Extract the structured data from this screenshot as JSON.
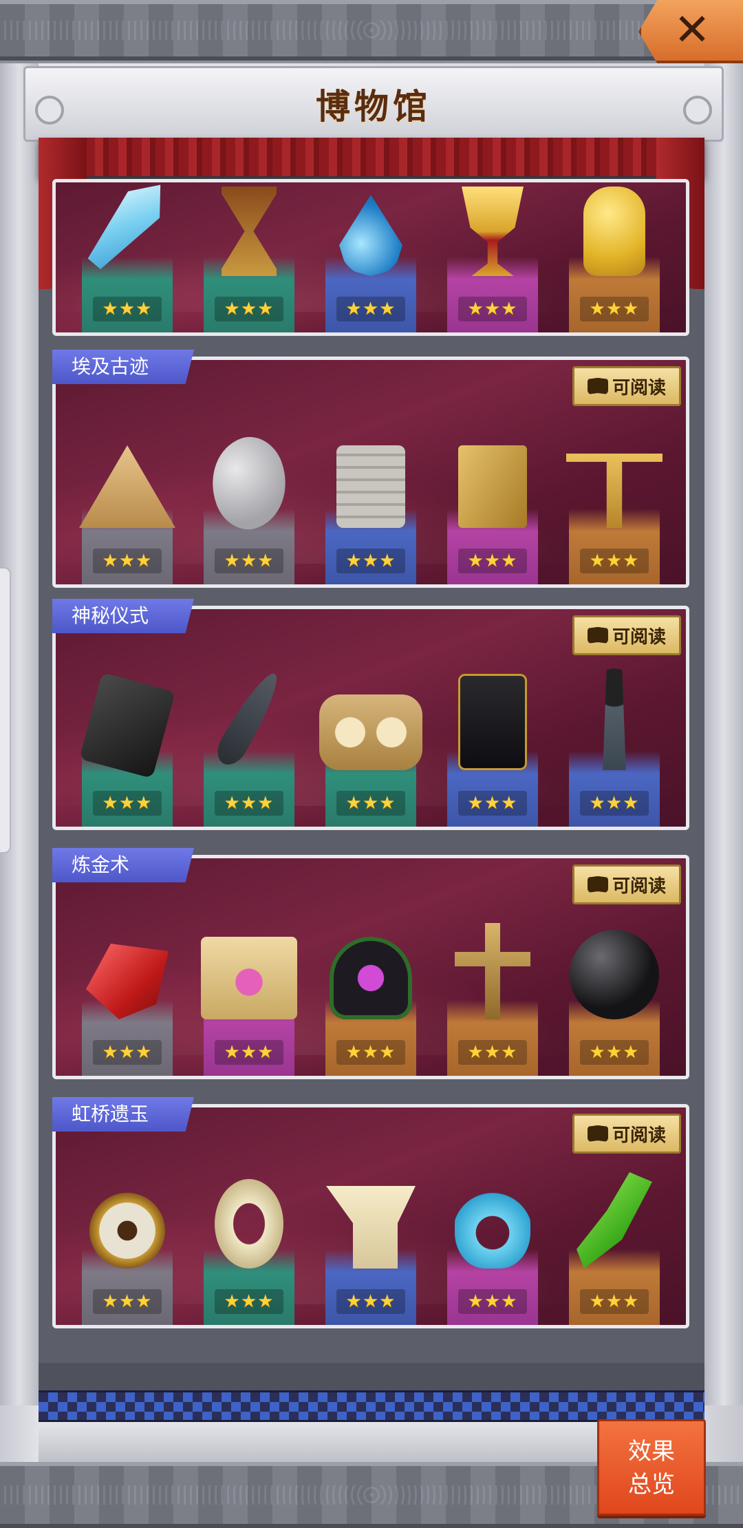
{
  "header": {
    "title": "博物馆",
    "close_icon": "close-icon"
  },
  "panels": [
    {
      "id": "top",
      "name": "",
      "has_read_button": false,
      "items": [
        {
          "icon": "ice-crystal-blade",
          "stars": "★★★",
          "rarity": "teal"
        },
        {
          "icon": "hourglass",
          "stars": "★★★",
          "rarity": "teal"
        },
        {
          "icon": "water-drop",
          "stars": "★★★",
          "rarity": "blue"
        },
        {
          "icon": "jeweled-goblet",
          "stars": "★★★",
          "rarity": "pink"
        },
        {
          "icon": "golden-cobra",
          "stars": "★★★",
          "rarity": "gold"
        }
      ]
    },
    {
      "id": "egypt",
      "name": "埃及古迹",
      "read_label": "可阅读",
      "items": [
        {
          "icon": "eye-pyramid",
          "stars": "★★★",
          "rarity": "gray"
        },
        {
          "icon": "stone-fish",
          "stars": "★★★",
          "rarity": "gray"
        },
        {
          "icon": "glyph-tablet",
          "stars": "★★★",
          "rarity": "blue"
        },
        {
          "icon": "golden-book",
          "stars": "★★★",
          "rarity": "pink"
        },
        {
          "icon": "golden-scales",
          "stars": "★★★",
          "rarity": "gold"
        }
      ]
    },
    {
      "id": "ritual",
      "name": "神秘仪式",
      "read_label": "可阅读",
      "items": [
        {
          "icon": "rune-stone",
          "stars": "★★★",
          "rarity": "teal"
        },
        {
          "icon": "dark-feather",
          "stars": "★★★",
          "rarity": "teal"
        },
        {
          "icon": "owl-mask",
          "stars": "★★★",
          "rarity": "teal"
        },
        {
          "icon": "pentagram-book",
          "stars": "★★★",
          "rarity": "blue"
        },
        {
          "icon": "hanging-charm",
          "stars": "★★★",
          "rarity": "blue"
        }
      ]
    },
    {
      "id": "alchemy",
      "name": "炼金术",
      "read_label": "可阅读",
      "items": [
        {
          "icon": "ruby-gem",
          "stars": "★★★",
          "rarity": "gray"
        },
        {
          "icon": "magic-scroll",
          "stars": "★★★",
          "rarity": "pink"
        },
        {
          "icon": "cauldron",
          "stars": "★★★",
          "rarity": "gold"
        },
        {
          "icon": "caduceus-cross",
          "stars": "★★★",
          "rarity": "gold"
        },
        {
          "icon": "dark-orb",
          "stars": "★★★",
          "rarity": "gold"
        }
      ]
    },
    {
      "id": "jade",
      "name": "虹桥遗玉",
      "read_label": "可阅读",
      "items": [
        {
          "icon": "jade-coin",
          "stars": "★★★",
          "rarity": "gray"
        },
        {
          "icon": "jade-ring",
          "stars": "★★★",
          "rarity": "teal"
        },
        {
          "icon": "jade-vessel",
          "stars": "★★★",
          "rarity": "blue"
        },
        {
          "icon": "jade-dragon",
          "stars": "★★★",
          "rarity": "pink"
        },
        {
          "icon": "green-jade-blade",
          "stars": "★★★",
          "rarity": "gold"
        }
      ]
    }
  ],
  "footer": {
    "overview_line1": "效果",
    "overview_line2": "总览"
  },
  "colors": {
    "ribbon": "#5a63d8",
    "panel_bg": "#6b1f3a",
    "overview_button": "#ea5a2a",
    "close_button": "#e8863e"
  }
}
